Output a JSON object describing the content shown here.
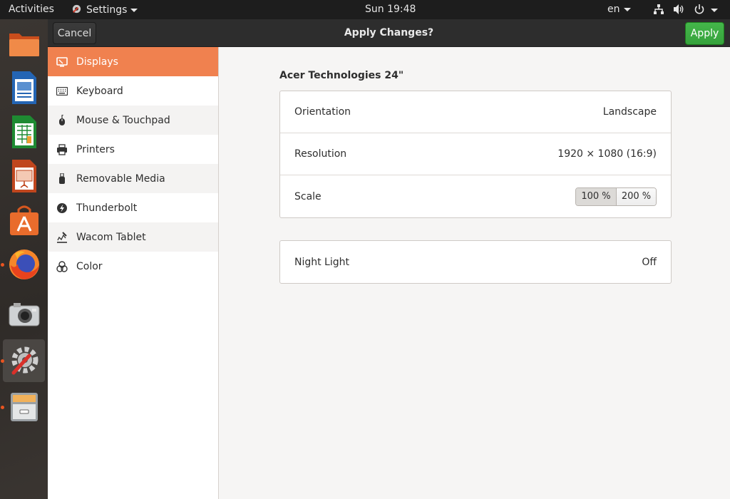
{
  "topbar": {
    "activities": "Activities",
    "app_menu": "Settings",
    "clock": "Sun 19:48",
    "keyboard_layout": "en"
  },
  "dock": {
    "items": [
      {
        "icon": "files-icon"
      },
      {
        "icon": "writer-icon"
      },
      {
        "icon": "calc-icon"
      },
      {
        "icon": "impress-icon"
      },
      {
        "icon": "software-icon"
      },
      {
        "icon": "firefox-icon"
      },
      {
        "icon": "camera-icon"
      },
      {
        "icon": "settings-icon"
      },
      {
        "icon": "archive-icon"
      }
    ]
  },
  "headerbar": {
    "cancel_label": "Cancel",
    "title": "Apply Changes?",
    "apply_label": "Apply"
  },
  "sidebar": {
    "items": [
      {
        "label": "Displays",
        "icon": "display-icon",
        "selected": true
      },
      {
        "label": "Keyboard",
        "icon": "keyboard-icon"
      },
      {
        "label": "Mouse & Touchpad",
        "icon": "mouse-icon"
      },
      {
        "label": "Printers",
        "icon": "printer-icon"
      },
      {
        "label": "Removable Media",
        "icon": "usb-icon"
      },
      {
        "label": "Thunderbolt",
        "icon": "thunderbolt-icon"
      },
      {
        "label": "Wacom Tablet",
        "icon": "tablet-icon"
      },
      {
        "label": "Color",
        "icon": "color-icon"
      }
    ]
  },
  "display": {
    "monitor_name": "Acer Technologies 24\"",
    "orientation_label": "Orientation",
    "orientation_value": "Landscape",
    "resolution_label": "Resolution",
    "resolution_value": "1920 × 1080 (16:9)",
    "scale_label": "Scale",
    "scale_options": [
      "100 %",
      "200 %"
    ],
    "scale_selected": "100 %",
    "night_light_label": "Night Light",
    "night_light_value": "Off"
  },
  "colors": {
    "accent": "#f0814f",
    "apply_green": "#3cac42",
    "ubuntu_orange": "#e95420"
  }
}
